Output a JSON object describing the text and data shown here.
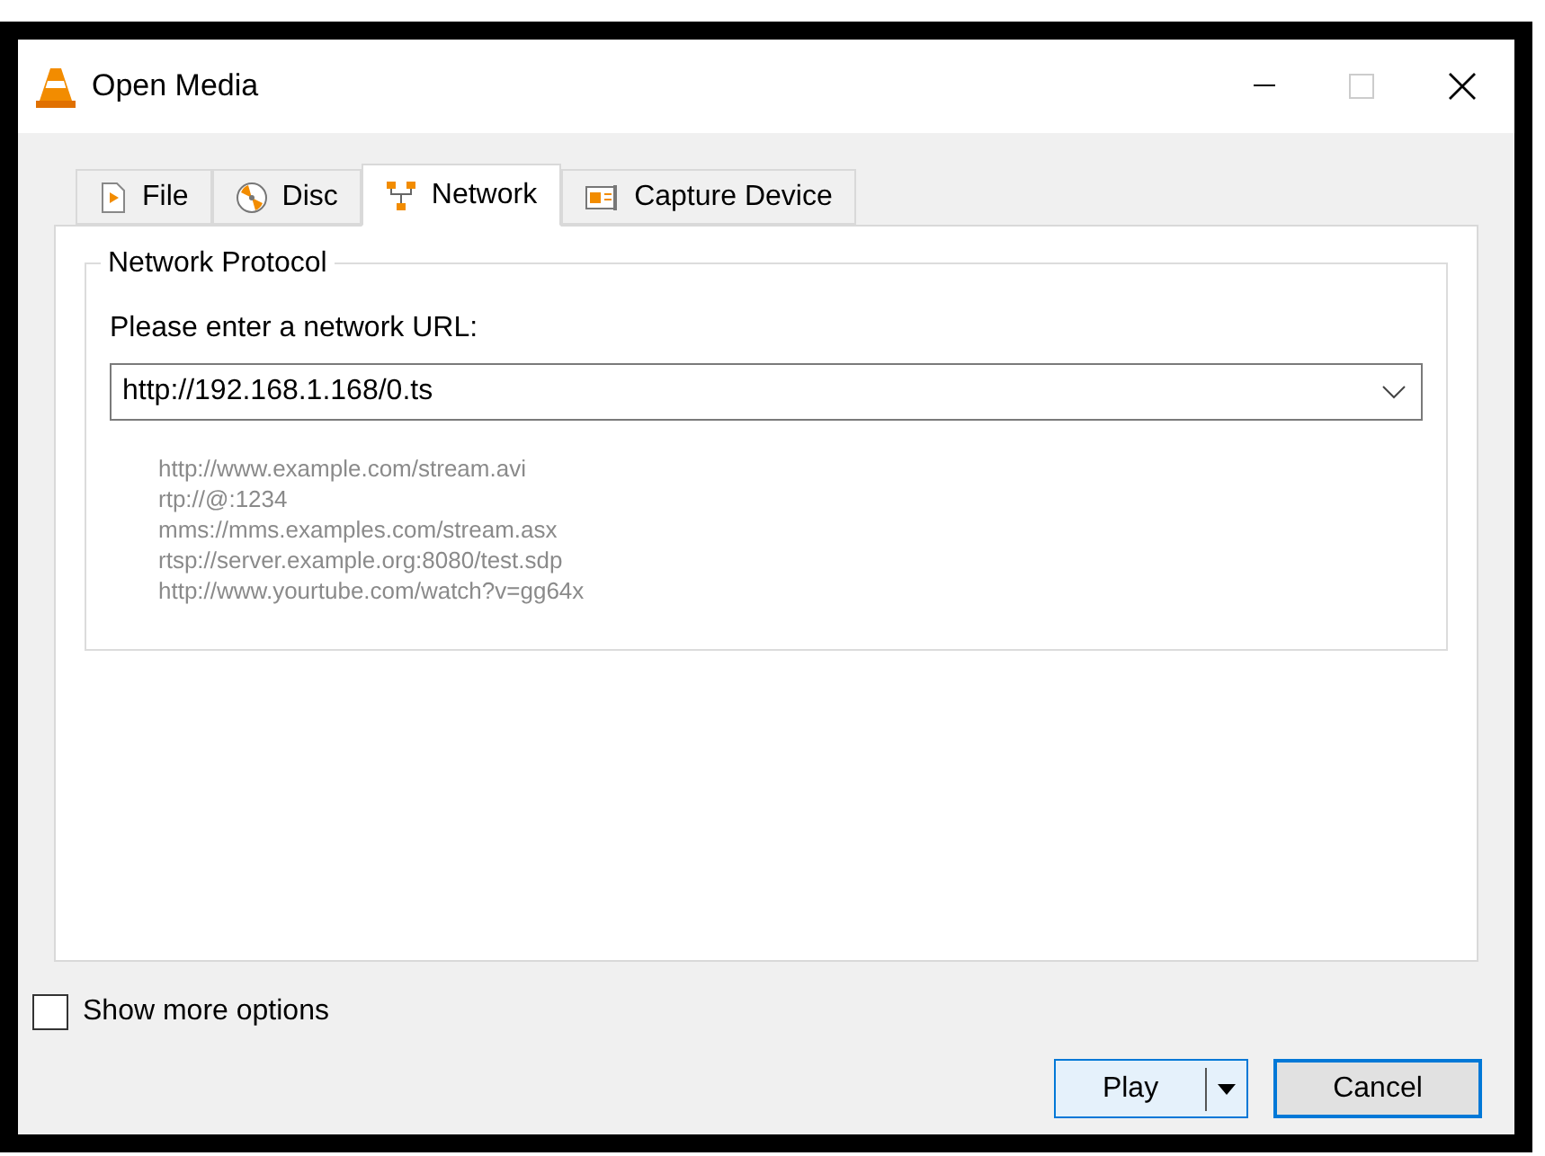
{
  "window": {
    "title": "Open Media"
  },
  "tabs": [
    {
      "label": "File",
      "kind": "file",
      "selected": false
    },
    {
      "label": "Disc",
      "kind": "disc",
      "selected": false
    },
    {
      "label": "Network",
      "kind": "network",
      "selected": true
    },
    {
      "label": "Capture Device",
      "kind": "capture",
      "selected": false
    }
  ],
  "group": {
    "title": "Network Protocol",
    "prompt": "Please enter a network URL:",
    "url": {
      "value": "http://192.168.1.168/0.ts"
    },
    "examples": [
      "http://www.example.com/stream.avi",
      "rtp://@:1234",
      "mms://mms.examples.com/stream.asx",
      "rtsp://server.example.org:8080/test.sdp",
      "http://www.yourtube.com/watch?v=gg64x"
    ]
  },
  "show_more_options": {
    "label": "Show more options",
    "checked": false
  },
  "buttons": {
    "play": "Play",
    "cancel": "Cancel"
  }
}
